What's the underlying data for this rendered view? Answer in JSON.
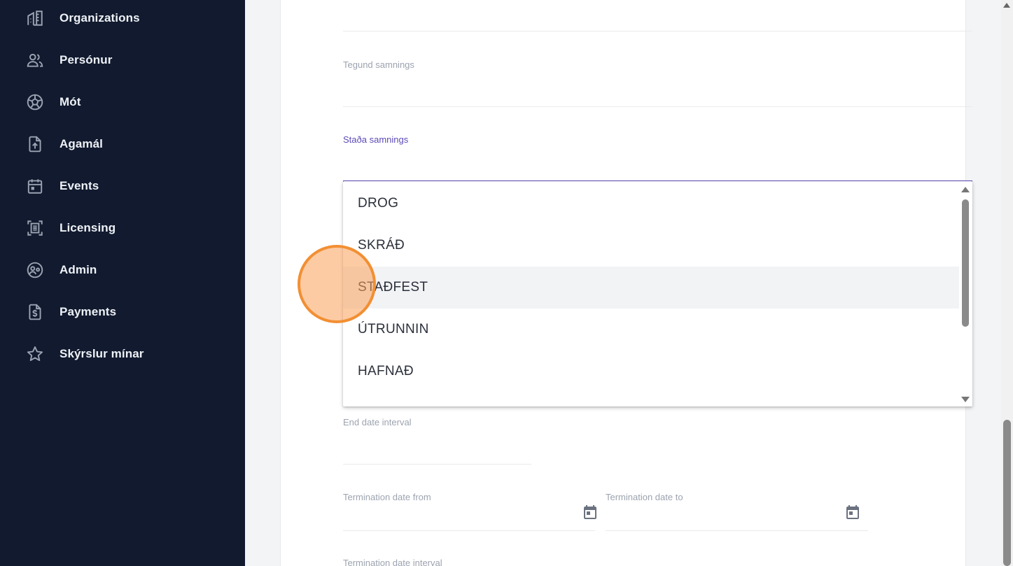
{
  "sidebar": {
    "items": [
      {
        "label": "Organizations",
        "icon": "building-icon"
      },
      {
        "label": "Persónur",
        "icon": "people-icon"
      },
      {
        "label": "Mót",
        "icon": "soccer-ball-icon"
      },
      {
        "label": "Agamál",
        "icon": "file-upload-icon"
      },
      {
        "label": "Events",
        "icon": "calendar-icon"
      },
      {
        "label": "Licensing",
        "icon": "license-icon"
      },
      {
        "label": "Admin",
        "icon": "admin-icon"
      },
      {
        "label": "Payments",
        "icon": "invoice-dollar-icon"
      },
      {
        "label": "Skýrslur mínar",
        "icon": "star-icon"
      }
    ]
  },
  "form": {
    "tegund_label": "Tegund samnings",
    "stada_label": "Staða samnings",
    "end_date_interval_label": "End date interval",
    "termination_from_label": "Termination date from",
    "termination_to_label": "Termination date to",
    "termination_interval_label": "Termination date interval"
  },
  "dropdown": {
    "options": [
      "DROG",
      "SKRÁÐ",
      "STAÐFEST",
      "ÚTRUNNIN",
      "HAFNAÐ"
    ],
    "hovered": "STAÐFEST"
  },
  "colors": {
    "sidebar_bg": "#111a2e",
    "accent": "#5b4bb7",
    "click_indicator": "#f28928"
  }
}
